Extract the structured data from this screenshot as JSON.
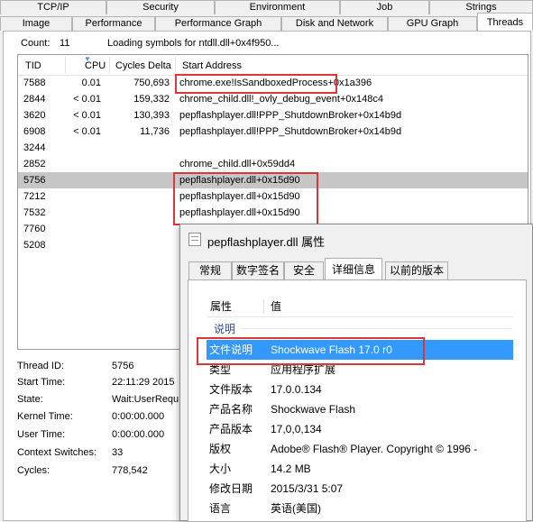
{
  "tabs_row1": [
    "TCP/IP",
    "Security",
    "Environment",
    "Job",
    "Strings"
  ],
  "tabs_row2": [
    "Image",
    "Performance",
    "Performance Graph",
    "Disk and Network",
    "GPU Graph",
    "Threads"
  ],
  "count_label": "Count:",
  "count_value": "11",
  "loading_text": "Loading symbols for ntdll.dll+0x4f950...",
  "columns": [
    "TID",
    "CPU",
    "Cycles Delta",
    "Start Address"
  ],
  "threads": [
    {
      "tid": "7588",
      "cpu": "0.01",
      "cycles": "750,693",
      "addr": "chrome.exe!IsSandboxedProcess",
      "addr_suffix": "+0x1a396"
    },
    {
      "tid": "2844",
      "cpu": "< 0.01",
      "cycles": "159,332",
      "addr": "chrome_child.dll!_ovly_debug_event+0x148c4",
      "addr_suffix": ""
    },
    {
      "tid": "3620",
      "cpu": "< 0.01",
      "cycles": "130,393",
      "addr": "pepflashplayer.dll!PPP_ShutdownBroker+0x14b9d",
      "addr_suffix": ""
    },
    {
      "tid": "6908",
      "cpu": "< 0.01",
      "cycles": "11,736",
      "addr": "pepflashplayer.dll!PPP_ShutdownBroker+0x14b9d",
      "addr_suffix": ""
    },
    {
      "tid": "3244",
      "cpu": "",
      "cycles": "",
      "addr": "",
      "addr_suffix": ""
    },
    {
      "tid": "2852",
      "cpu": "",
      "cycles": "",
      "addr": "chrome_child.dll+0x59dd4",
      "addr_suffix": ""
    },
    {
      "tid": "5756",
      "cpu": "",
      "cycles": "",
      "addr": "pepflashplayer.dll+0x15d90",
      "addr_suffix": ""
    },
    {
      "tid": "7212",
      "cpu": "",
      "cycles": "",
      "addr": "pepflashplayer.dll+0x15d90",
      "addr_suffix": ""
    },
    {
      "tid": "7532",
      "cpu": "",
      "cycles": "",
      "addr": "pepflashplayer.dll+0x15d90",
      "addr_suffix": ""
    },
    {
      "tid": "7760",
      "cpu": "",
      "cycles": "",
      "addr": "",
      "addr_suffix": ""
    },
    {
      "tid": "5208",
      "cpu": "",
      "cycles": "",
      "addr": "",
      "addr_suffix": ""
    }
  ],
  "thread_info": [
    {
      "label": "Thread ID:",
      "value": "5756"
    },
    {
      "label": "Start Time:",
      "value": "22:11:29  2015"
    },
    {
      "label": "State:",
      "value": "Wait:UserRequ"
    },
    {
      "label": "Kernel Time:",
      "value": "0:00:00.000"
    },
    {
      "label": "User Time:",
      "value": "0:00:00.000"
    },
    {
      "label": "Context Switches:",
      "value": "33"
    },
    {
      "label": "Cycles:",
      "value": "778,542"
    }
  ],
  "dialog": {
    "title": "pepflashplayer.dll 属性",
    "tabs": [
      "常规",
      "数字签名",
      "安全",
      "详细信息",
      "以前的版本"
    ],
    "header_attr": "属性",
    "header_value": "值",
    "section": "说明",
    "rows": [
      {
        "k": "文件说明",
        "v": "Shockwave Flash 17.0 r0"
      },
      {
        "k": "类型",
        "v": "应用程序扩展"
      },
      {
        "k": "文件版本",
        "v": "17.0.0.134"
      },
      {
        "k": "产品名称",
        "v": "Shockwave Flash"
      },
      {
        "k": "产品版本",
        "v": "17,0,0,134"
      },
      {
        "k": "版权",
        "v": "Adobe® Flash® Player. Copyright © 1996 -"
      },
      {
        "k": "大小",
        "v": "14.2 MB"
      },
      {
        "k": "修改日期",
        "v": "2015/3/31 5:07"
      },
      {
        "k": "语言",
        "v": "英语(美国)"
      }
    ]
  },
  "colors": {
    "highlight_box": "#d9383a",
    "selected_row": "#c6c6c6",
    "dialog_selected_row": "#3399ff"
  }
}
